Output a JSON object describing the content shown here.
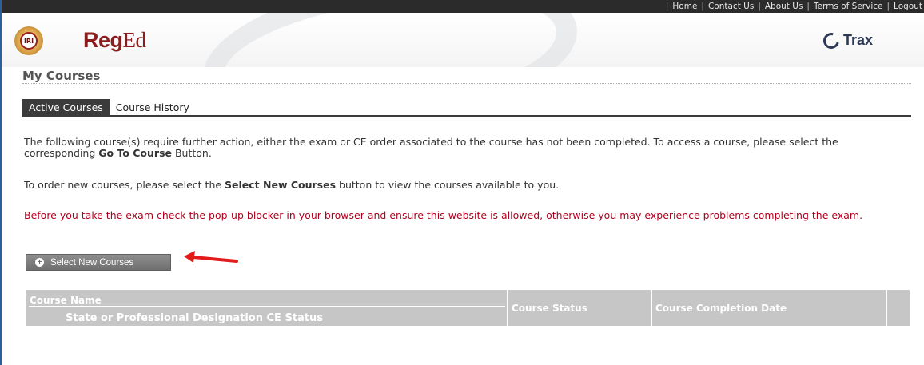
{
  "topnav": {
    "links": [
      "Home",
      "Contact Us",
      "About Us",
      "Terms of Service",
      "Logout"
    ]
  },
  "header": {
    "seal_text": "IRI",
    "brand_bold": "Reg",
    "brand_light": "Ed",
    "partner_logo": "Trax"
  },
  "page": {
    "title": "My Courses",
    "tabs": [
      {
        "label": "Active Courses",
        "active": true
      },
      {
        "label": "Course History",
        "active": false
      }
    ]
  },
  "content": {
    "para1_prefix": "The following course(s) require further action, either the exam or CE order associated to the course has not been completed. To access a course, please select the corresponding ",
    "para1_bold": "Go To Course",
    "para1_suffix": " Button.",
    "para2_prefix": "To order new courses, please select the ",
    "para2_bold": "Select New Courses",
    "para2_suffix": " button to view the courses available to you.",
    "warning": "Before you take the exam check the pop-up blocker in your browser and ensure this website is allowed, otherwise you may experience problems completing the exam."
  },
  "button": {
    "label": "Select New Courses",
    "icon": "plus-circle-icon"
  },
  "table": {
    "course_name": "Course Name",
    "designation": "State or Professional Designation CE Status",
    "course_status": "Course Status",
    "completion_date": "Course Completion Date"
  },
  "colors": {
    "topnav_bg": "#2b2b2b",
    "brand_red": "#8c1d1d",
    "warning_red": "#b2001e",
    "header_gray": "#c6c6c6",
    "arrow_red": "#e21b1b"
  }
}
